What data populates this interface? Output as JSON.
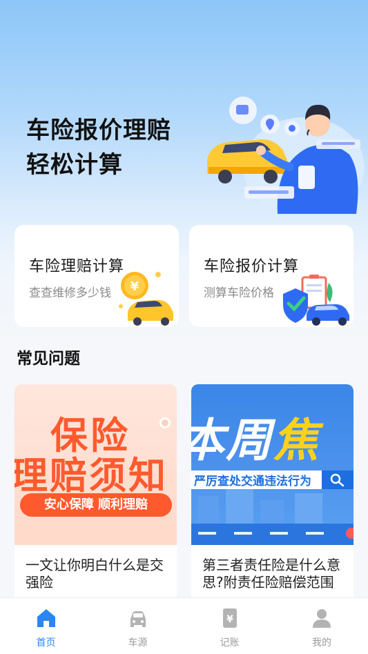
{
  "hero": {
    "title_line1": "车险报价理赔",
    "title_line2": "轻松计算"
  },
  "features": [
    {
      "title": "车险理赔计算",
      "subtitle": "查查维修多少钱",
      "icon": "coin-car-icon"
    },
    {
      "title": "车险报价计算",
      "subtitle": "测算车险价格",
      "icon": "shield-car-icon"
    }
  ],
  "faq": {
    "section_title": "常见问题",
    "articles": [
      {
        "thumb_line1": "保险",
        "thumb_line2": "理赔须知",
        "thumb_pill": "安心保障 顺利理赔",
        "title": "一文让你明白什么是交强险"
      },
      {
        "thumb_big_white": "本周",
        "thumb_big_yellow": "焦",
        "thumb_search": "严厉查处交通违法行为",
        "title": "第三者责任险是什么意思?附责任险赔偿范围"
      }
    ]
  },
  "nav": [
    {
      "label": "首页",
      "icon": "home-icon",
      "active": true
    },
    {
      "label": "车源",
      "icon": "car-icon",
      "active": false
    },
    {
      "label": "记账",
      "icon": "ledger-icon",
      "active": false
    },
    {
      "label": "我的",
      "icon": "user-icon",
      "active": false
    }
  ],
  "colors": {
    "accent": "#2a86f0",
    "nav_inactive": "#9a9a9a",
    "thumb1_orange": "#ff5a2e",
    "thumb2_blue": "#3b86e8"
  }
}
